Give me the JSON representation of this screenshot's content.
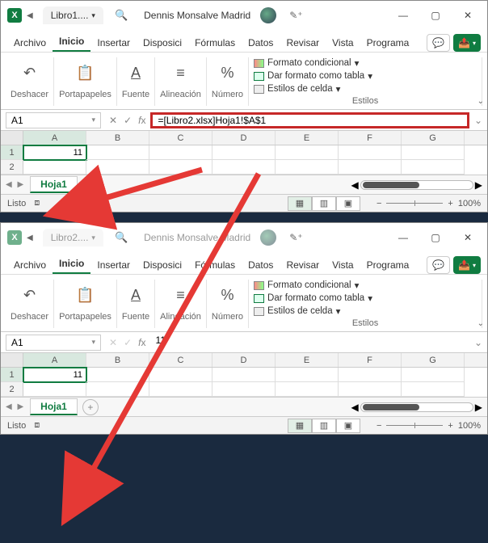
{
  "top": {
    "filename": "Libro1....",
    "user": "Dennis Monsalve Madrid",
    "menu": [
      "Archivo",
      "Inicio",
      "Insertar",
      "Disposici",
      "Fórmulas",
      "Datos",
      "Revisar",
      "Vista",
      "Programa"
    ],
    "active_menu": "Inicio",
    "groups": {
      "undo": "Deshacer",
      "clipboard": "Portapapeles",
      "font": "Fuente",
      "align": "Alineación",
      "number": "Número",
      "styles": "Estilos",
      "cond": "Formato condicional",
      "table": "Dar formato como tabla",
      "cellstyles": "Estilos de celda"
    },
    "namebox": "A1",
    "formula": "=[Libro2.xlsx]Hoja1!$A$1",
    "columns": [
      "A",
      "B",
      "C",
      "D",
      "E",
      "F",
      "G"
    ],
    "rows": [
      "1",
      "2"
    ],
    "cell_a1": "11",
    "sheet": "Hoja1",
    "status": "Listo",
    "zoom": "100%"
  },
  "bottom": {
    "filename": "Libro2....",
    "user": "Dennis Monsalve Madrid",
    "menu": [
      "Archivo",
      "Inicio",
      "Insertar",
      "Disposici",
      "Fórmulas",
      "Datos",
      "Revisar",
      "Vista",
      "Programa"
    ],
    "active_menu": "Inicio",
    "groups": {
      "undo": "Deshacer",
      "clipboard": "Portapapeles",
      "font": "Fuente",
      "align": "Alineación",
      "number": "Número",
      "styles": "Estilos",
      "cond": "Formato condicional",
      "table": "Dar formato como tabla",
      "cellstyles": "Estilos de celda"
    },
    "namebox": "A1",
    "formula": "11",
    "columns": [
      "A",
      "B",
      "C",
      "D",
      "E",
      "F",
      "G"
    ],
    "rows": [
      "1",
      "2"
    ],
    "cell_a1": "11",
    "sheet": "Hoja1",
    "status": "Listo",
    "zoom": "100%"
  }
}
